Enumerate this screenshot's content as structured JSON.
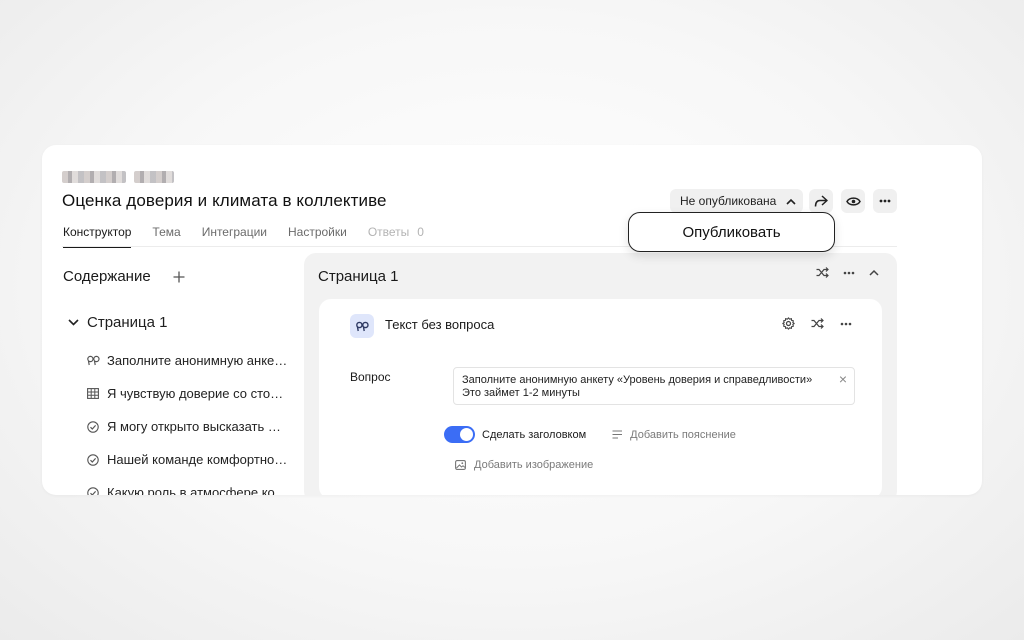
{
  "header": {
    "title": "Оценка доверия и климата в коллективе",
    "status_label": "Не опубликована"
  },
  "tabs": [
    {
      "label": "Конструктор",
      "active": true
    },
    {
      "label": "Тема"
    },
    {
      "label": "Интеграции"
    },
    {
      "label": "Настройки"
    },
    {
      "label": "Ответы",
      "count": "0",
      "disabled": true
    }
  ],
  "sidebar": {
    "title": "Содержание",
    "add_icon": "plus-icon",
    "page_label": "Страница 1",
    "items": [
      {
        "icon": "quote-icon",
        "label": "Заполните анонимную анке…"
      },
      {
        "icon": "table-icon",
        "label": "Я чувствую доверие со сто…"
      },
      {
        "icon": "check-circle-icon",
        "label": "Я могу открыто высказать …"
      },
      {
        "icon": "check-circle-icon",
        "label": "Нашей команде комфортно…"
      },
      {
        "icon": "check-circle-icon",
        "label": "Какую роль в атмосфере ко…"
      }
    ]
  },
  "page_panel": {
    "title": "Страница 1"
  },
  "question_card": {
    "title": "Текст без вопроса",
    "question_label": "Вопрос",
    "question_line1": "Заполните анонимную анкету «Уровень доверия и справедливости»",
    "question_line2": "Это займет 1-2 минуты",
    "toggle_label": "Сделать заголовком",
    "toggle_on": true,
    "add_hint": "Добавить пояснение",
    "add_image": "Добавить изображение"
  },
  "tooltip": {
    "label": "Опубликовать"
  },
  "colors": {
    "accent": "#3b6df5",
    "badge_bg": "#dfe6fb"
  }
}
